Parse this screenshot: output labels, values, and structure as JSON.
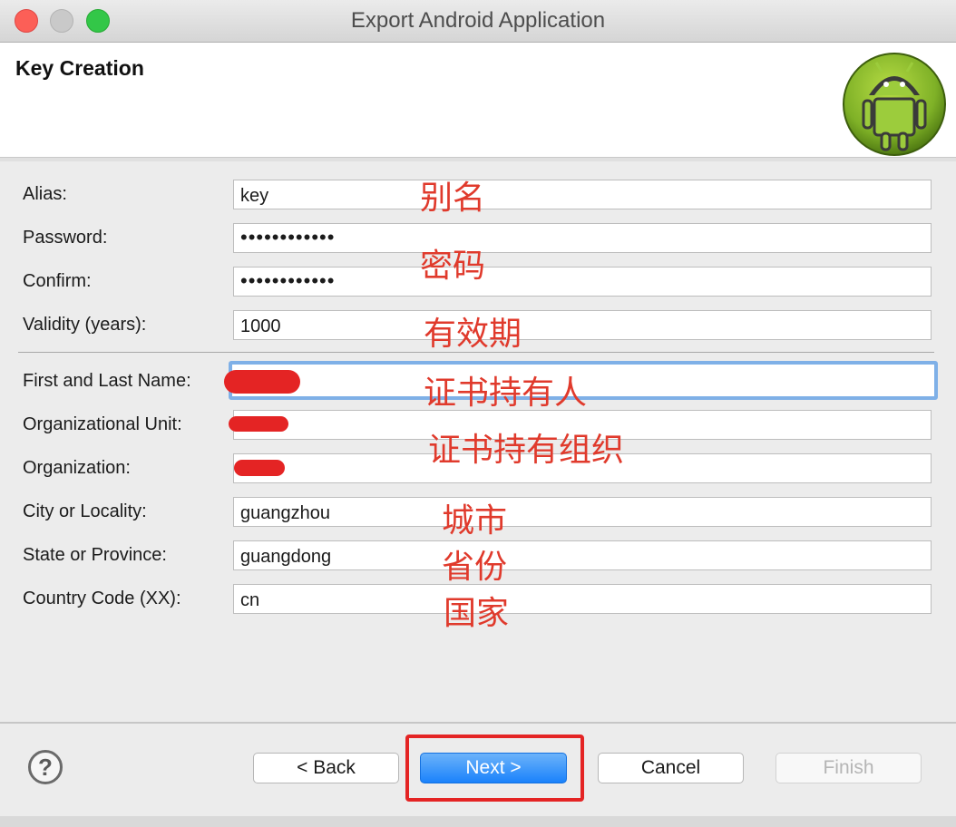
{
  "window": {
    "title": "Export Android Application"
  },
  "header": {
    "title": "Key Creation",
    "logo_icon": "android-logo"
  },
  "form": {
    "alias": {
      "label": "Alias:",
      "value": "key"
    },
    "password": {
      "label": "Password:",
      "value": "••••••••••••"
    },
    "confirm": {
      "label": "Confirm:",
      "value": "••••••••••••"
    },
    "validity": {
      "label": "Validity (years):",
      "value": "1000"
    },
    "first_last_name": {
      "label": "First and Last Name:",
      "value": ""
    },
    "org_unit": {
      "label": "Organizational Unit:",
      "value": ""
    },
    "organization": {
      "label": "Organization:",
      "value": ""
    },
    "city": {
      "label": "City or Locality:",
      "value": "guangzhou"
    },
    "state": {
      "label": "State or Province:",
      "value": "guangdong"
    },
    "country": {
      "label": "Country Code (XX):",
      "value": "cn"
    }
  },
  "annotations": {
    "alias": "别名",
    "password": "密码",
    "validity": "有效期",
    "name": "证书持有人",
    "org": "证书持有组织",
    "city": "城市",
    "province": "省份",
    "country": "国家"
  },
  "footer": {
    "help_label": "?",
    "back_label": "< Back",
    "next_label": "Next >",
    "cancel_label": "Cancel",
    "finish_label": "Finish"
  },
  "colors": {
    "annotation": "#e03a2c",
    "primary_button": "#1a82fb",
    "focus_ring": "#7fb0e7"
  }
}
